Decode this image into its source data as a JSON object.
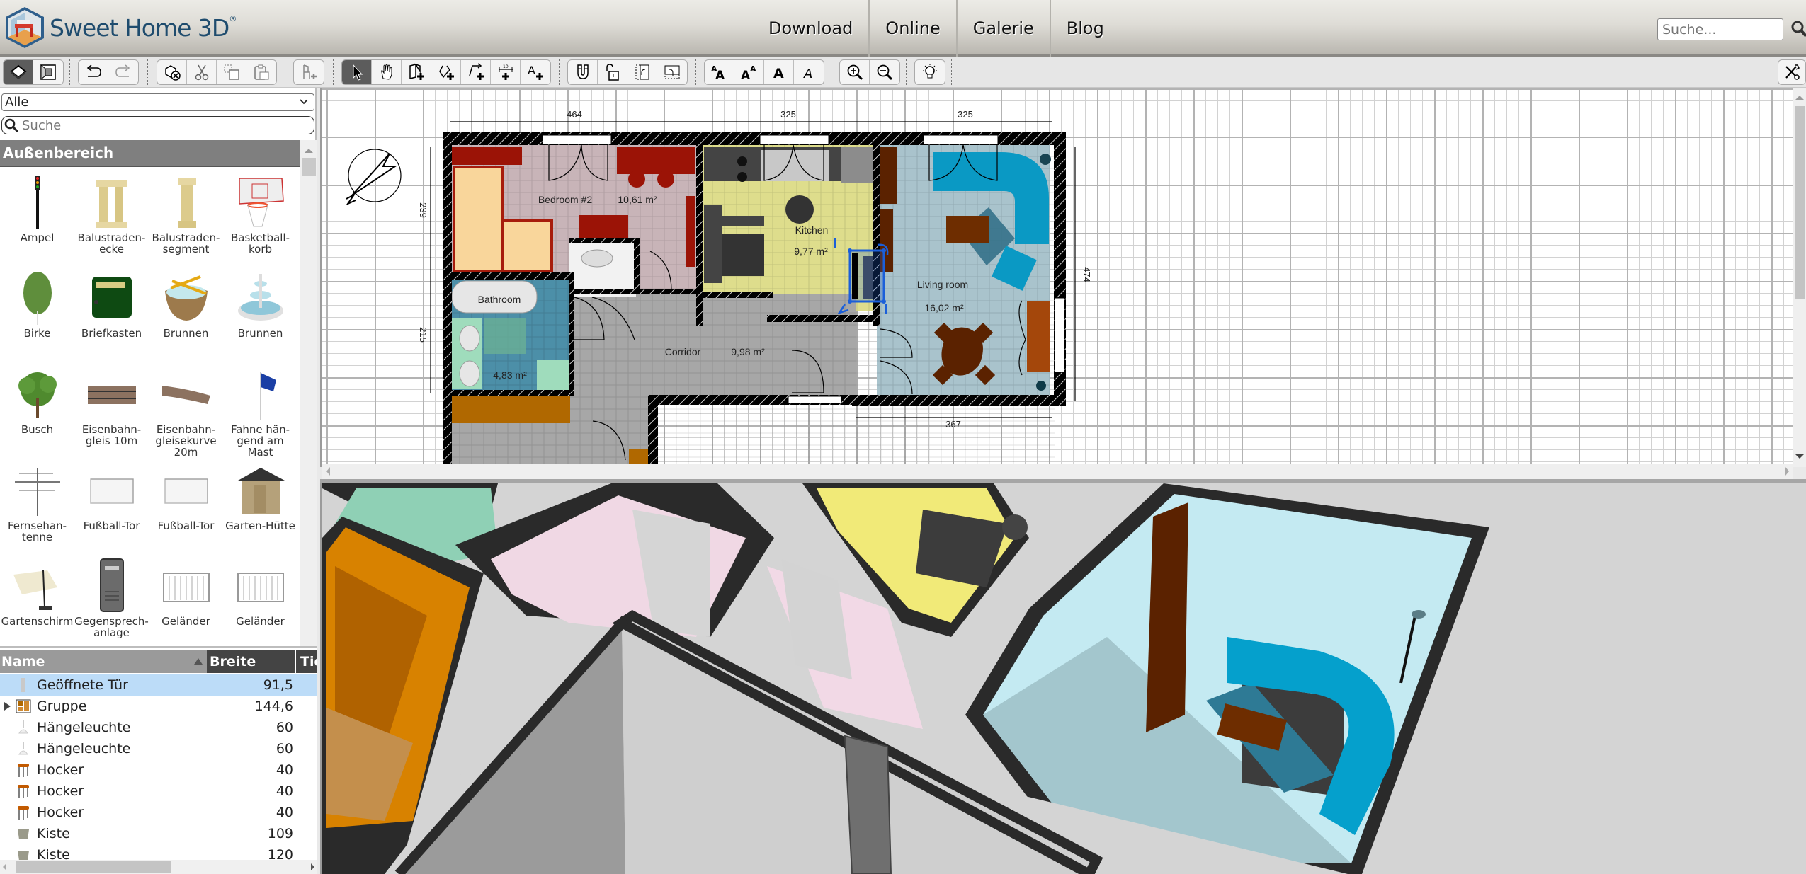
{
  "app": {
    "title": "Sweet Home 3D",
    "registered_mark": "®"
  },
  "nav": {
    "items": [
      "Download",
      "Online",
      "Galerie",
      "Blog"
    ]
  },
  "top_search": {
    "placeholder": "Suche..."
  },
  "toolbar": {
    "groups": [
      [
        "plan-view-icon",
        "3d-view-icon"
      ],
      [
        "undo-icon",
        "redo-icon"
      ],
      [
        "delete-furniture-icon",
        "cut-icon",
        "copy-icon",
        "paste-icon"
      ],
      [
        "add-furniture-icon"
      ],
      [
        "select-icon",
        "pan-icon",
        "create-walls-icon",
        "create-rooms-icon",
        "create-polylines-icon",
        "create-dimensions-icon",
        "add-text-icon"
      ],
      [
        "magnetism-icon",
        "lock-icon",
        "rotate-left-icon",
        "rotate-right-icon"
      ],
      [
        "increase-text-icon",
        "decrease-text-icon",
        "bold-text-icon",
        "italic-text-icon"
      ],
      [
        "zoom-in-icon",
        "zoom-out-icon"
      ],
      [
        "light-bulb-icon"
      ]
    ],
    "active": "select-icon",
    "preferences_icon": "preferences-icon"
  },
  "catalog": {
    "category_selected": "Alle",
    "search_placeholder": "Suche",
    "group_header": "Außenbereich",
    "items": [
      {
        "label": "Ampel",
        "icon": "traffic-light-icon"
      },
      {
        "label": "Balustraden-\necke",
        "icon": "balustrade-corner-icon"
      },
      {
        "label": "Balustraden-\nsegment",
        "icon": "balustrade-segment-icon"
      },
      {
        "label": "Basketball-\nkorb",
        "icon": "basketball-hoop-icon"
      },
      {
        "label": "Birke",
        "icon": "birch-tree-icon"
      },
      {
        "label": "Briefkasten",
        "icon": "mailbox-icon"
      },
      {
        "label": "Brunnen",
        "icon": "well-icon"
      },
      {
        "label": "Brunnen",
        "icon": "fountain-icon"
      },
      {
        "label": "Busch",
        "icon": "bush-icon"
      },
      {
        "label": "Eisenbahn-\ngleis 10m",
        "icon": "railway-track-icon"
      },
      {
        "label": "Eisenbahn-\ngleisekurve\n20m",
        "icon": "railway-curve-icon"
      },
      {
        "label": "Fahne hän-\ngend am Mast",
        "icon": "flag-icon"
      },
      {
        "label": "Fernsehan-\ntenne",
        "icon": "tv-antenna-icon"
      },
      {
        "label": "Fußball-Tor",
        "icon": "soccer-goal-icon"
      },
      {
        "label": "Fußball-Tor",
        "icon": "soccer-goal-icon"
      },
      {
        "label": "Garten-Hütte",
        "icon": "garden-shed-icon"
      },
      {
        "label": "Gartenschirm",
        "icon": "parasol-icon"
      },
      {
        "label": "Gegensprech-\nanlage",
        "icon": "intercom-icon"
      },
      {
        "label": "Geländer",
        "icon": "railing-icon"
      },
      {
        "label": "Geländer",
        "icon": "railing-icon"
      }
    ]
  },
  "furniture_table": {
    "columns": [
      "Name",
      "Breite",
      "Tie"
    ],
    "sorted_column": "Name",
    "rows": [
      {
        "name": "Geöffnete Tür",
        "width": "91,5",
        "icon": "door-icon",
        "selected": true,
        "expandable": false
      },
      {
        "name": "Gruppe",
        "width": "144,6",
        "icon": "group-icon",
        "selected": false,
        "expandable": true
      },
      {
        "name": "Hängeleuchte",
        "width": "60",
        "icon": "pendant-lamp-icon",
        "selected": false,
        "expandable": false
      },
      {
        "name": "Hängeleuchte",
        "width": "60",
        "icon": "pendant-lamp-icon",
        "selected": false,
        "expandable": false
      },
      {
        "name": "Hocker",
        "width": "40",
        "icon": "stool-icon",
        "selected": false,
        "expandable": false
      },
      {
        "name": "Hocker",
        "width": "40",
        "icon": "stool-icon",
        "selected": false,
        "expandable": false
      },
      {
        "name": "Hocker",
        "width": "40",
        "icon": "stool-icon",
        "selected": false,
        "expandable": false
      },
      {
        "name": "Kiste",
        "width": "109",
        "icon": "box-icon",
        "selected": false,
        "expandable": false
      },
      {
        "name": "Kiste",
        "width": "120",
        "icon": "box-icon",
        "selected": false,
        "expandable": false
      }
    ]
  },
  "plan": {
    "rooms": [
      {
        "name": "Bedroom #2",
        "area": "10,61 m²"
      },
      {
        "name": "Kitchen",
        "area": "9,77 m²"
      },
      {
        "name": "Living room",
        "area": "16,02 m²"
      },
      {
        "name": "Bathroom",
        "area": "4,83 m²"
      },
      {
        "name": "Corridor",
        "area": "9,98 m²"
      }
    ],
    "dimensions": {
      "top_left": "464",
      "top_middle": "325",
      "top_right": "325",
      "left_upper": "239",
      "left_lower": "215",
      "right": "474",
      "bottom": "367"
    }
  },
  "colors": {
    "bedroom_floor": "#c8b4b8",
    "kitchen_floor": "#dedd8c",
    "living_floor": "#a9c3cc",
    "bathroom_floor": "#4c8fa8",
    "corridor_floor": "#a7a7a7",
    "wall": "#000000",
    "bed": "#f9d69b",
    "bed_frame": "#a71c0c",
    "bedroom_furniture": "#9b1306",
    "sofa": "#0a99c4",
    "wood": "#5b2200",
    "selection": "#1b5fd9",
    "selected_row": "#bcdcf8"
  }
}
